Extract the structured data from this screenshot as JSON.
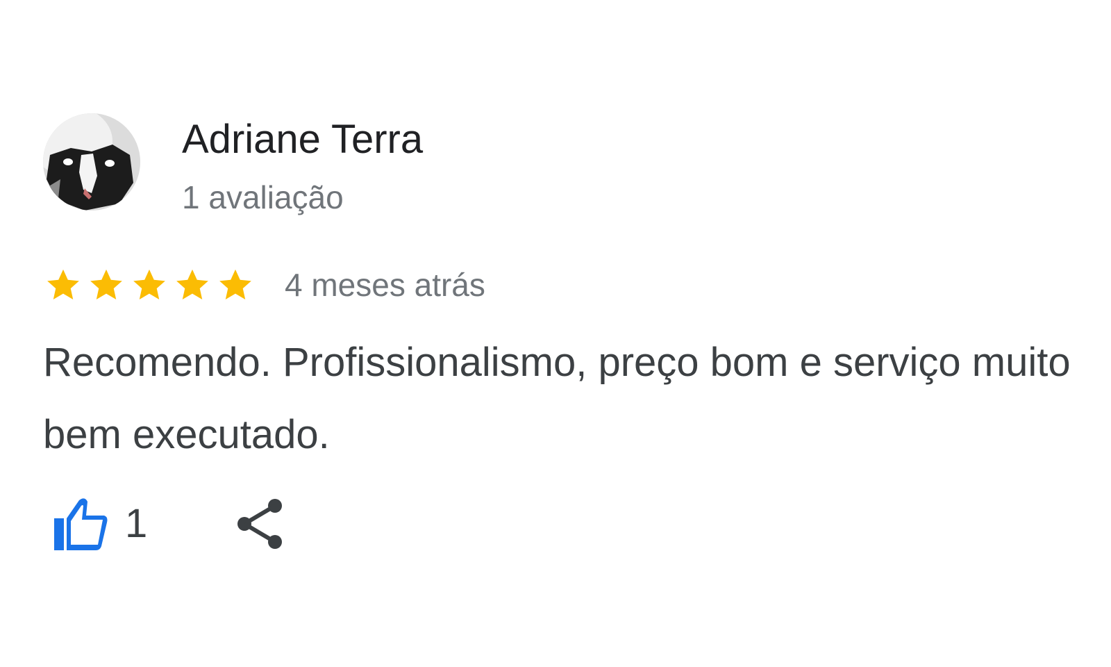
{
  "review": {
    "author_name": "Adriane Terra",
    "author_review_count": "1 avaliação",
    "rating": 5,
    "rating_max": 5,
    "time_ago": "4 meses atrás",
    "text": "Recomendo. Profissionalismo, preço bom e serviço muito bem executado.",
    "likes": "1"
  },
  "icons": {
    "avatar": "avatar-image",
    "star": "star-icon",
    "like": "thumbs-up-icon",
    "share": "share-icon"
  },
  "colors": {
    "star": "#fbbc04",
    "like_icon": "#1a73e8",
    "share_icon": "#3c4043",
    "name": "#202124",
    "secondary_text": "#70757a",
    "body_text": "#3c4043"
  }
}
